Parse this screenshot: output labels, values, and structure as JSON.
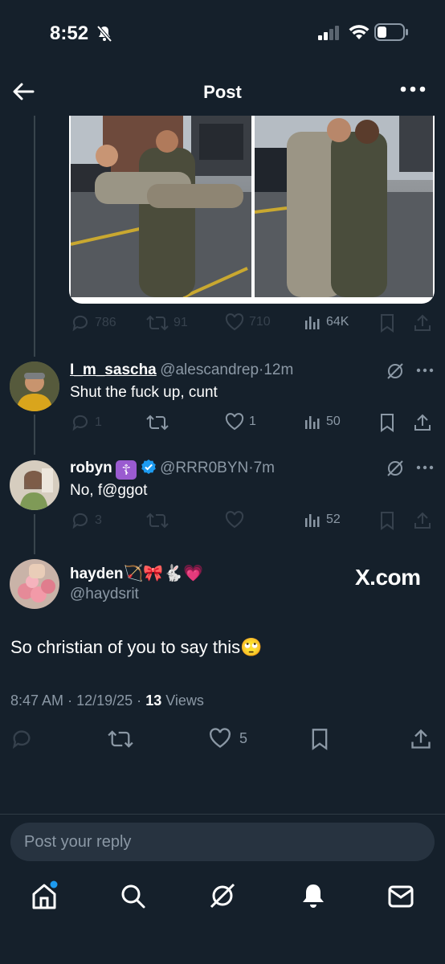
{
  "status_bar": {
    "time": "8:52"
  },
  "header": {
    "title": "Post"
  },
  "original_post": {
    "stats": {
      "replies": "786",
      "reposts": "91",
      "likes": "710",
      "views": "64K"
    }
  },
  "replies": [
    {
      "name": "I_m_sascha",
      "handle": "@alescandrep",
      "sep": "·",
      "time": "12m",
      "text": "Shut the fuck up, cunt",
      "stats": {
        "replies": "1",
        "likes": "1",
        "views": "50"
      }
    },
    {
      "name": "robyn",
      "badge": "☦",
      "handle": "@RRR0BYN",
      "sep": "·",
      "time": "7m",
      "text": "No, f@ggot",
      "stats": {
        "replies": "3",
        "views": "52"
      }
    }
  ],
  "focused_post": {
    "name": "hayden",
    "name_emojis": "🏹🎀🐇💗",
    "handle": "@haydsrit",
    "watermark": "X.com",
    "text": "So christian of you to say this",
    "text_emoji": "🙄",
    "time": "8:47 AM",
    "date": "12/19/25",
    "views_count": "13",
    "views_label": "Views",
    "meta_sep": "·",
    "likes": "5"
  },
  "compose": {
    "placeholder": "Post your reply"
  },
  "bottom_nav": [
    "home-icon",
    "search-icon",
    "grok-icon",
    "notifications-icon",
    "messages-icon"
  ],
  "colors": {
    "background": "#15202b",
    "accent": "#1d9bf0",
    "text_muted": "#8b98a5"
  }
}
